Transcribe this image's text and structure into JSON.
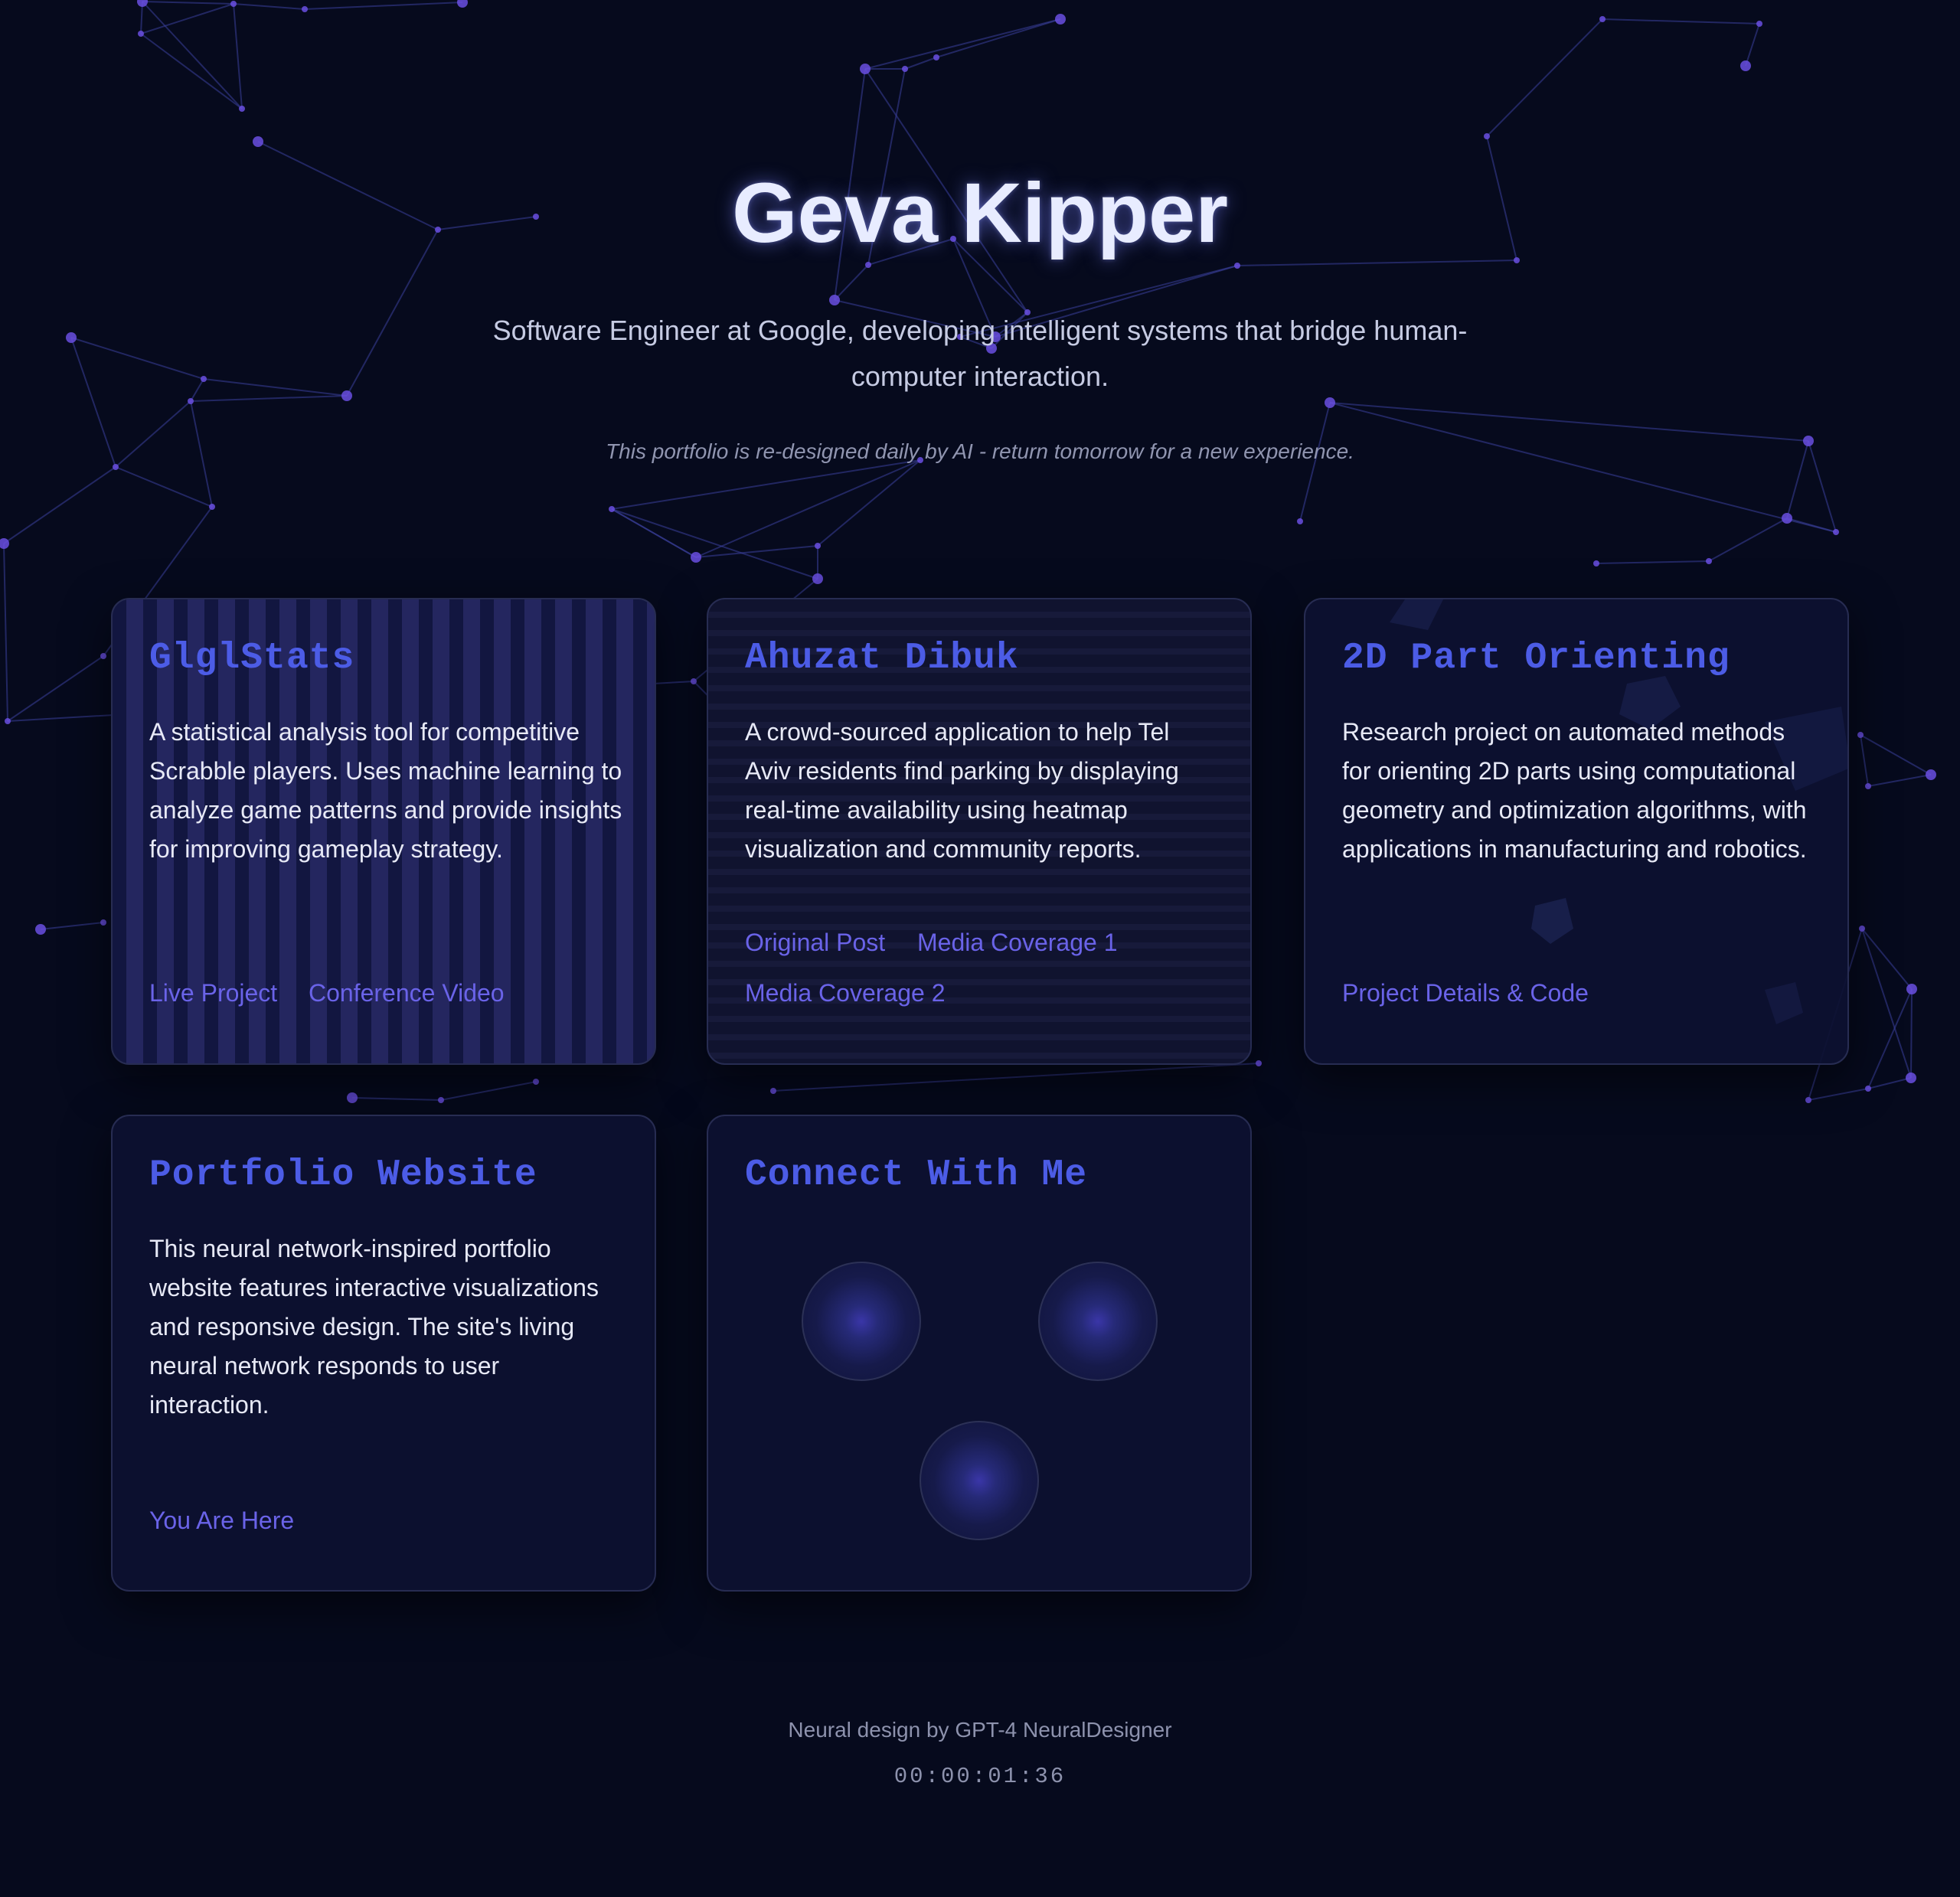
{
  "hero": {
    "name": "Geva Kipper",
    "subtitle": "Software Engineer at Google, developing intelligent systems that bridge human-computer interaction.",
    "note": "This portfolio is re-designed daily by AI - return tomorrow for a new experience."
  },
  "projects": [
    {
      "title": "GlglStats",
      "description": "A statistical analysis tool for competitive Scrabble players. Uses machine learning to analyze game patterns and provide insights for improving gameplay strategy.",
      "links": [
        "Live Project",
        "Conference Video"
      ]
    },
    {
      "title": "Ahuzat Dibuk",
      "description": "A crowd-sourced application to help Tel Aviv residents find parking by displaying real-time availability using heatmap visualization and community reports.",
      "links": [
        "Original Post",
        "Media Coverage 1",
        "Media Coverage 2"
      ]
    },
    {
      "title": "2D Part Orienting",
      "description": "Research project on automated methods for orienting 2D parts using computational geometry and optimization algorithms, with applications in manufacturing and robotics.",
      "links": [
        "Project Details & Code"
      ]
    },
    {
      "title": "Portfolio Website",
      "description": "This neural network-inspired portfolio website features interactive visualizations and responsive design. The site's living neural network responds to user interaction.",
      "links": [
        "You Are Here"
      ]
    }
  ],
  "connect": {
    "title": "Connect With Me"
  },
  "footer": {
    "credit": "Neural design by GPT-4 NeuralDesigner",
    "timer": "00:00:01:36"
  },
  "colors": {
    "background": "#060a1d",
    "accent_title": "#4c5ce6",
    "link": "#6a63e8",
    "node": "#6a4fe0",
    "edge": "#3a3f9a"
  }
}
